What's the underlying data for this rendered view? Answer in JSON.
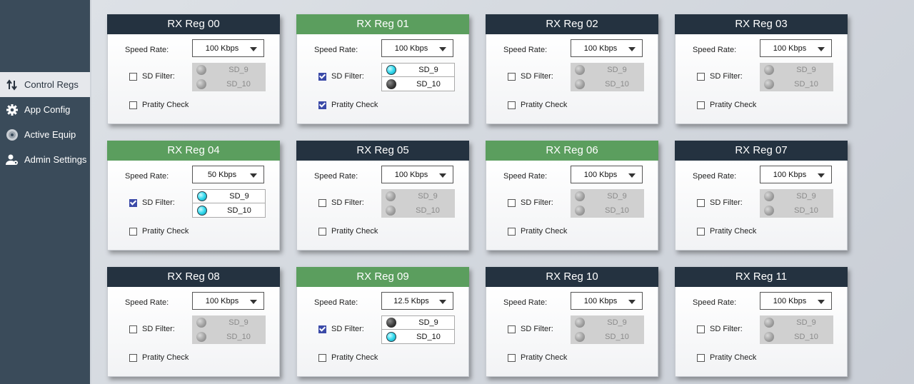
{
  "sidebar": {
    "items": [
      {
        "label": "Control Regs",
        "icon": "up-down-arrows-icon",
        "active": true
      },
      {
        "label": "App Config",
        "icon": "gear-icon",
        "active": false
      },
      {
        "label": "Active Equip",
        "icon": "disc-icon",
        "active": false
      },
      {
        "label": "Admin Settings",
        "icon": "user-settings-icon",
        "active": false
      }
    ]
  },
  "labels": {
    "speed_rate": "Speed Rate:",
    "sd_filter": "SD Filter:",
    "parity_check": "Pratity Check"
  },
  "colors": {
    "header_inactive": "#243240",
    "header_active": "#5b9e5e",
    "checkbox_checked": "#3b4aa8",
    "led_on": "#31d9ee"
  },
  "registers": [
    {
      "title": "RX Reg 00",
      "active": false,
      "speed": "100 Kbps",
      "sd_filter": false,
      "parity": false,
      "sd": [
        {
          "label": "SD_9",
          "state": "grey"
        },
        {
          "label": "SD_10",
          "state": "grey"
        }
      ]
    },
    {
      "title": "RX Reg 01",
      "active": true,
      "speed": "100 Kbps",
      "sd_filter": true,
      "parity": true,
      "sd": [
        {
          "label": "SD_9",
          "state": "cyan"
        },
        {
          "label": "SD_10",
          "state": "dark"
        }
      ]
    },
    {
      "title": "RX Reg 02",
      "active": false,
      "speed": "100 Kbps",
      "sd_filter": false,
      "parity": false,
      "sd": [
        {
          "label": "SD_9",
          "state": "grey"
        },
        {
          "label": "SD_10",
          "state": "grey"
        }
      ]
    },
    {
      "title": "RX Reg 03",
      "active": false,
      "speed": "100 Kbps",
      "sd_filter": false,
      "parity": false,
      "sd": [
        {
          "label": "SD_9",
          "state": "grey"
        },
        {
          "label": "SD_10",
          "state": "grey"
        }
      ]
    },
    {
      "title": "RX Reg 04",
      "active": true,
      "speed": "50 Kbps",
      "sd_filter": true,
      "parity": false,
      "sd": [
        {
          "label": "SD_9",
          "state": "cyan"
        },
        {
          "label": "SD_10",
          "state": "cyan"
        }
      ]
    },
    {
      "title": "RX Reg 05",
      "active": false,
      "speed": "100 Kbps",
      "sd_filter": false,
      "parity": false,
      "sd": [
        {
          "label": "SD_9",
          "state": "grey"
        },
        {
          "label": "SD_10",
          "state": "grey"
        }
      ]
    },
    {
      "title": "RX Reg 06",
      "active": true,
      "speed": "100 Kbps",
      "sd_filter": false,
      "parity": false,
      "sd": [
        {
          "label": "SD_9",
          "state": "grey"
        },
        {
          "label": "SD_10",
          "state": "grey"
        }
      ]
    },
    {
      "title": "RX Reg 07",
      "active": false,
      "speed": "100 Kbps",
      "sd_filter": false,
      "parity": false,
      "sd": [
        {
          "label": "SD_9",
          "state": "grey"
        },
        {
          "label": "SD_10",
          "state": "grey"
        }
      ]
    },
    {
      "title": "RX Reg 08",
      "active": false,
      "speed": "100 Kbps",
      "sd_filter": false,
      "parity": false,
      "sd": [
        {
          "label": "SD_9",
          "state": "grey"
        },
        {
          "label": "SD_10",
          "state": "grey"
        }
      ]
    },
    {
      "title": "RX Reg 09",
      "active": true,
      "speed": "12.5 Kbps",
      "sd_filter": true,
      "parity": false,
      "sd": [
        {
          "label": "SD_9",
          "state": "dark"
        },
        {
          "label": "SD_10",
          "state": "cyan"
        }
      ]
    },
    {
      "title": "RX Reg 10",
      "active": false,
      "speed": "100 Kbps",
      "sd_filter": false,
      "parity": false,
      "sd": [
        {
          "label": "SD_9",
          "state": "grey"
        },
        {
          "label": "SD_10",
          "state": "grey"
        }
      ]
    },
    {
      "title": "RX Reg 11",
      "active": false,
      "speed": "100 Kbps",
      "sd_filter": false,
      "parity": false,
      "sd": [
        {
          "label": "SD_9",
          "state": "grey"
        },
        {
          "label": "SD_10",
          "state": "grey"
        }
      ]
    }
  ]
}
